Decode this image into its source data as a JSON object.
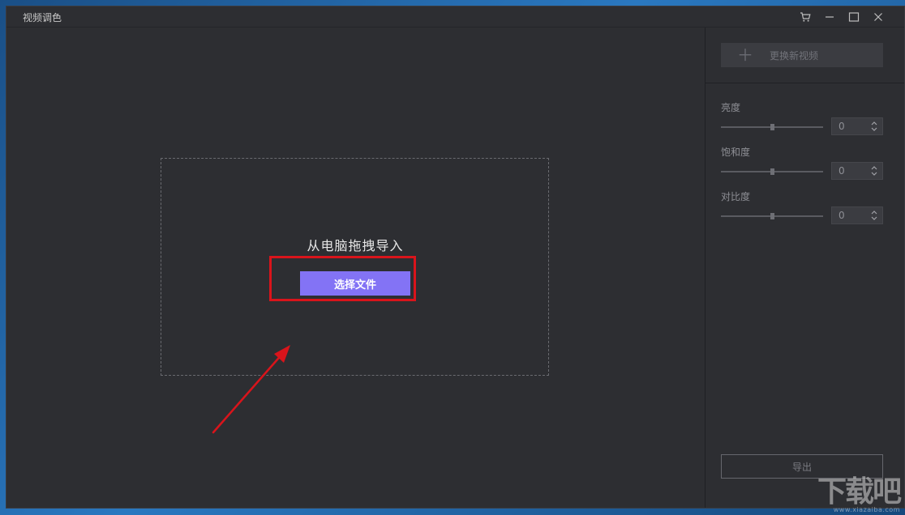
{
  "window": {
    "title": "视频调色"
  },
  "titlebar": {
    "cart_icon": "cart-icon",
    "minimize_icon": "minimize-icon",
    "maximize_icon": "maximize-icon",
    "close_icon": "close-icon"
  },
  "main": {
    "drop_text": "从电脑拖拽导入",
    "choose_file_label": "选择文件"
  },
  "sidebar": {
    "replace_video_label": "更换新视频",
    "controls": [
      {
        "label": "亮度",
        "value": "0",
        "level": 0.5
      },
      {
        "label": "饱和度",
        "value": "0",
        "level": 0.5
      },
      {
        "label": "对比度",
        "value": "0",
        "level": 0.5
      }
    ],
    "export_label": "导出"
  },
  "watermark": {
    "glyphs": "下载吧",
    "site": "www.xiazaiba.com"
  },
  "colors": {
    "accent": "#8373f5",
    "annotation": "#d9141b",
    "window_bg": "#2d2e32"
  }
}
